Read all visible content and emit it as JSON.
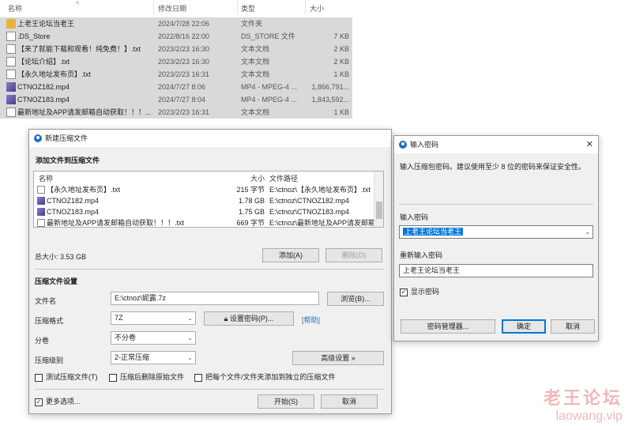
{
  "explorer": {
    "columns": [
      "名称",
      "修改日期",
      "类型",
      "大小"
    ],
    "rows": [
      {
        "icon": "folder-icon",
        "name": "上老王论坛当老王",
        "date": "2024/7/28 22:06",
        "type": "文件夹",
        "size": ""
      },
      {
        "icon": "document-icon",
        "name": ".DS_Store",
        "date": "2022/8/16 22:00",
        "type": "DS_STORE 文件",
        "size": "7 KB"
      },
      {
        "icon": "document-icon",
        "name": "【来了就能下载和观看！纯免费！】.txt",
        "date": "2023/2/23 16:30",
        "type": "文本文档",
        "size": "2 KB"
      },
      {
        "icon": "document-icon",
        "name": "【论坛介绍】.txt",
        "date": "2023/2/23 16:30",
        "type": "文本文档",
        "size": "2 KB"
      },
      {
        "icon": "document-icon",
        "name": "【永久地址发布页】.txt",
        "date": "2023/2/23 16:31",
        "type": "文本文档",
        "size": "1 KB"
      },
      {
        "icon": "video-icon",
        "name": "CTNOZ182.mp4",
        "date": "2024/7/27 8:06",
        "type": "MP4 - MPEG-4 ...",
        "size": "1,866,791..."
      },
      {
        "icon": "video-icon",
        "name": "CTNOZ183.mp4",
        "date": "2024/7/27 8:04",
        "type": "MP4 - MPEG-4 ...",
        "size": "1,843,592..."
      },
      {
        "icon": "document-icon",
        "name": "最新地址及APP请发邮箱自动获取！！！...",
        "date": "2023/2/23 16:31",
        "type": "文本文档",
        "size": "1 KB"
      }
    ]
  },
  "archive": {
    "title": "新建压缩文件",
    "add_section": "添加文件到压缩文件",
    "list_headers": {
      "name": "名称",
      "size": "大小",
      "path": "文件路径"
    },
    "files": [
      {
        "icon": "document-icon",
        "name": "【永久地址发布页】.txt",
        "size": "215 字节",
        "path": "E:\\ctnoz\\【永久地址发布页】.txt"
      },
      {
        "icon": "video-icon",
        "name": "CTNOZ182.mp4",
        "size": "1.78 GB",
        "path": "E:\\ctnoz\\CTNOZ182.mp4"
      },
      {
        "icon": "video-icon",
        "name": "CTNOZ183.mp4",
        "size": "1.75 GB",
        "path": "E:\\ctnoz\\CTNOZ183.mp4"
      },
      {
        "icon": "document-icon",
        "name": "最新地址及APP请发邮箱自动获取！！！.txt",
        "size": "669 字节",
        "path": "E:\\ctnoz\\最新地址及APP请发邮箱"
      }
    ],
    "total_size": "总大小: 3.53 GB",
    "add_button": "添加(A)",
    "delete_button": "删除(D)",
    "settings_section": "压缩文件设置",
    "filename_label": "文件名",
    "filename_value": "E:\\ctnoz\\妮露.7z",
    "browse_button": "浏览(B)...",
    "format_label": "压缩格式",
    "format_value": "7Z",
    "set_password_button": "设置密码(P)...",
    "help_link": "[帮助]",
    "split_label": "分卷",
    "split_value": "不分卷",
    "level_label": "压缩级别",
    "level_value": "2-正常压缩",
    "advanced_button": "高级设置 »",
    "test_checkbox": "测试压缩文件(T)",
    "delete_original_checkbox": "压缩后删除原始文件",
    "separate_checkbox": "把每个文件/文件夹添加到独立的压缩文件",
    "more_options_checkbox": "更多选项...",
    "start_button": "开始(S)",
    "cancel_button": "取消"
  },
  "password": {
    "title": "输入密码",
    "description": "输入压缩包密码。建议使用至少 8 位的密码来保证安全性。",
    "enter_label": "输入密码",
    "enter_value": "上老王论坛当老王",
    "reenter_label": "重新输入密码",
    "reenter_value": "上老王论坛当老王",
    "show_password_checkbox": "显示密码",
    "manager_button": "密码管理器...",
    "ok_button": "确定",
    "cancel_button": "取消"
  },
  "watermark": {
    "line1": "老王论坛",
    "line2": "laowang.vip"
  },
  "colors": {
    "accent": "#0078d7",
    "selection": "#d9d9d9",
    "watermark": "#f1b8b8"
  }
}
